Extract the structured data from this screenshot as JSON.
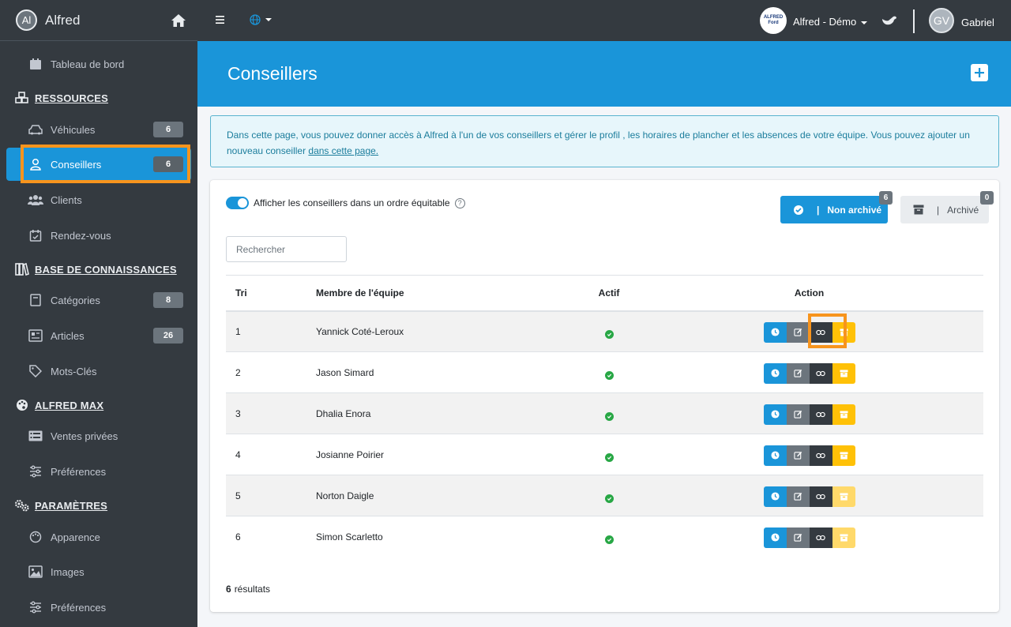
{
  "brand": {
    "initials": "Al",
    "name": "Alfred"
  },
  "sidebar": {
    "items": [
      {
        "key": "dashboard",
        "label": "Tableau de bord"
      },
      {
        "key": "vehicules",
        "label": "Véhicules",
        "badge": "6"
      },
      {
        "key": "conseillers",
        "label": "Conseillers",
        "badge": "6"
      },
      {
        "key": "clients",
        "label": "Clients"
      },
      {
        "key": "rdv",
        "label": "Rendez-vous"
      },
      {
        "key": "categories",
        "label": "Catégories",
        "badge": "8"
      },
      {
        "key": "articles",
        "label": "Articles",
        "badge": "26"
      },
      {
        "key": "motscles",
        "label": "Mots-Clés"
      },
      {
        "key": "ventes",
        "label": "Ventes privées"
      },
      {
        "key": "prefs1",
        "label": "Préférences"
      },
      {
        "key": "apparence",
        "label": "Apparence"
      },
      {
        "key": "images",
        "label": "Images"
      },
      {
        "key": "prefs2",
        "label": "Préférences"
      }
    ],
    "headers": {
      "ressources": "RESSOURCES",
      "connaissances": "BASE DE CONNAISSANCES",
      "alfredmax": "ALFRED MAX",
      "parametres": "PARAMÈTRES"
    }
  },
  "topbar": {
    "dealer_logo_text": "ALFRED Ford",
    "dealer": "Alfred - Démo",
    "user_initials": "GV",
    "user_name": "Gabriel"
  },
  "page": {
    "title": "Conseillers"
  },
  "info": {
    "text": "Dans cette page, vous pouvez donner accès à Alfred à l'un de vos conseillers et gérer le profil , les horaires de plancher et les absences de votre équipe. Vous pouvez ajouter un nouveau conseiller ",
    "link": "dans cette page."
  },
  "card": {
    "toggle_label": "Afficher les conseillers dans un ordre équitable",
    "non_archive": {
      "label": "Non archivé",
      "count": "6"
    },
    "archive": {
      "label": "Archivé",
      "count": "0"
    },
    "search_placeholder": "Rechercher",
    "columns": {
      "tri": "Tri",
      "member": "Membre de l'équipe",
      "active": "Actif",
      "action": "Action"
    },
    "rows": [
      {
        "tri": "1",
        "name": "Yannick Coté-Leroux"
      },
      {
        "tri": "2",
        "name": "Jason Simard"
      },
      {
        "tri": "3",
        "name": "Dhalia Enora"
      },
      {
        "tri": "4",
        "name": "Josianne Poirier"
      },
      {
        "tri": "5",
        "name": "Norton Daigle"
      },
      {
        "tri": "6",
        "name": "Simon Scarletto"
      }
    ],
    "results_count": "6",
    "results_label": "résultats"
  },
  "colors": {
    "accent": "#1a95d9",
    "sidebar": "#343a40",
    "highlight": "#f7941d",
    "archive": "#ffc107",
    "success": "#28a745"
  }
}
